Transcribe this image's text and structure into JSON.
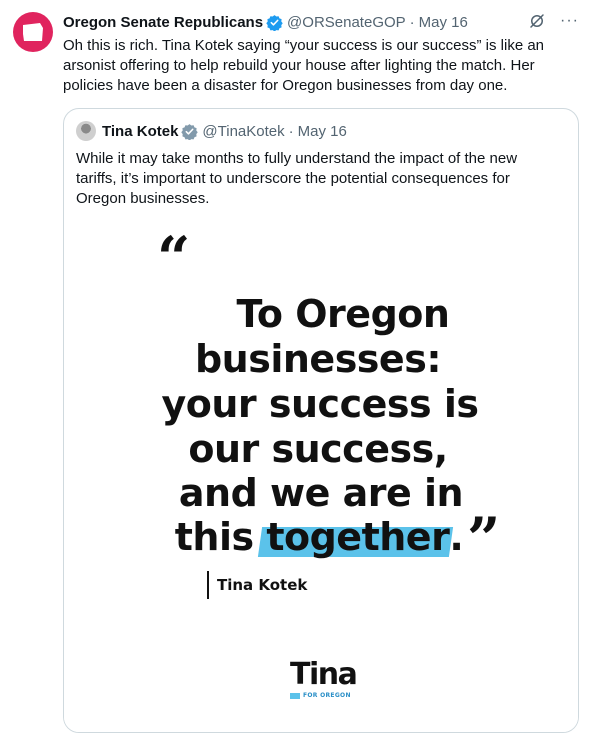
{
  "tweet": {
    "author_name": "Oregon Senate Republicans",
    "handle": "@ORSenateGOP",
    "separator": "·",
    "date": "May 16",
    "text": "Oh this is rich. Tina Kotek saying “your success is our success” is like an arsonist offering to help rebuild your house after lighting the match. Her policies have been a disaster for Oregon businesses from day one.",
    "more_label": "···",
    "avatar_icon": "oregon-state-icon",
    "avatar_color": "#e0245e",
    "verified_color": "#1d9bf0"
  },
  "quoted": {
    "author_name": "Tina Kotek",
    "handle": "@TinaKotek",
    "separator": "·",
    "date": "May 16",
    "text": "While it may take months to fully understand the impact of the new tariffs, it’s important to underscore the potential consequences for Oregon businesses."
  },
  "quote_image": {
    "open_mark": "“",
    "close_mark": "”",
    "lines": [
      "To Oregon",
      "businesses:",
      "your success is",
      "our success,",
      "and we are in"
    ],
    "last_line_prefix": "this ",
    "last_line_highlight": "together",
    "last_line_suffix": ".",
    "attribution": "Tina Kotek",
    "logo_word": "Tina",
    "logo_sub": "FOR OREGON",
    "highlight_color": "#5bc2ea"
  }
}
